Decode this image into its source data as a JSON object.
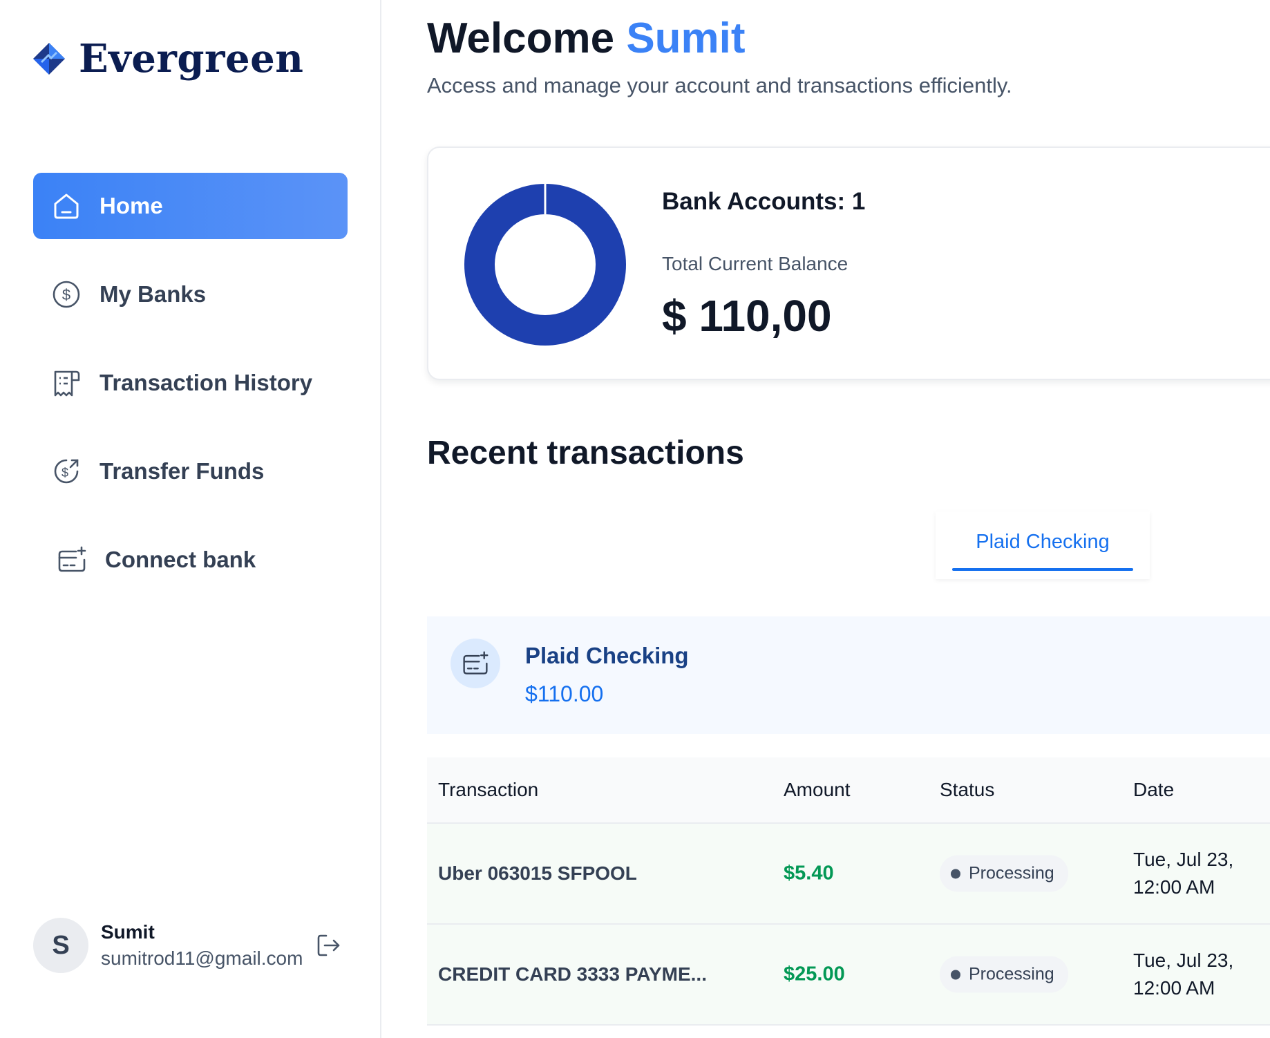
{
  "brand": {
    "name": "Evergreen",
    "logo_icon": "diamond-logo-icon"
  },
  "sidebar": {
    "items": [
      {
        "label": "Home",
        "icon": "home-icon",
        "active": true
      },
      {
        "label": "My Banks",
        "icon": "dollar-circle-icon",
        "active": false
      },
      {
        "label": "Transaction History",
        "icon": "receipt-icon",
        "active": false
      },
      {
        "label": "Transfer Funds",
        "icon": "money-send-icon",
        "active": false
      },
      {
        "label": "Connect bank",
        "icon": "card-add-icon",
        "active": false
      }
    ],
    "user": {
      "initial": "S",
      "name": "Sumit",
      "email": "sumitrod11@gmail.com"
    }
  },
  "header": {
    "welcome_prefix": "Welcome",
    "user_name": "Sumit",
    "subtitle": "Access and manage your account and transactions efficiently."
  },
  "balance": {
    "accounts_label": "Bank Accounts: 1",
    "total_label": "Total Current Balance",
    "total_amount": "$ 110,00",
    "donut_color": "#1e40af"
  },
  "recent": {
    "title": "Recent transactions",
    "tabs": [
      {
        "label": "Plaid Checking",
        "active": true
      }
    ],
    "account": {
      "name": "Plaid Checking",
      "balance": "$110.00"
    },
    "columns": [
      "Transaction",
      "Amount",
      "Status",
      "Date"
    ],
    "rows": [
      {
        "name": "Uber 063015 SFPOOL",
        "amount": "$5.40",
        "status": "Processing",
        "date_line1": "Tue, Jul 23,",
        "date_line2": "12:00 AM"
      },
      {
        "name": "CREDIT CARD 3333 PAYME...",
        "amount": "$25.00",
        "status": "Processing",
        "date_line1": "Tue, Jul 23,",
        "date_line2": "12:00 AM"
      }
    ]
  },
  "colors": {
    "accent": "#3b82f6",
    "positive": "#039855",
    "brand_navy": "#0b1d51"
  }
}
